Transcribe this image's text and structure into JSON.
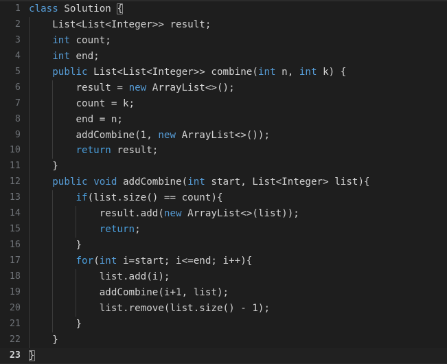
{
  "editor": {
    "name": "code-editor",
    "language": "java",
    "theme": "dark",
    "background_color": "#1e1e1e",
    "gutter_color": "#6e7277",
    "active_line_number": 23,
    "total_lines": 23,
    "colors": {
      "keyword": "#569cd6",
      "control_keyword": "#4a9edc",
      "text": "#d4d4d4",
      "active_line_bg": "#212121",
      "indent_guide": "#3b3b3b",
      "bracket_match_outline": "#8a8a8a"
    },
    "lines": [
      {
        "number": "1",
        "indent": 0,
        "tokens": [
          {
            "t": "class",
            "c": "kw"
          },
          {
            "t": " Solution ",
            "c": "plain"
          },
          {
            "t": "{",
            "c": "plain",
            "match": true
          }
        ]
      },
      {
        "number": "2",
        "indent": 1,
        "tokens": [
          {
            "t": "    List<List<Integer>> result;",
            "c": "plain"
          }
        ]
      },
      {
        "number": "3",
        "indent": 1,
        "tokens": [
          {
            "t": "    ",
            "c": "plain"
          },
          {
            "t": "int",
            "c": "kw"
          },
          {
            "t": " count;",
            "c": "plain"
          }
        ]
      },
      {
        "number": "4",
        "indent": 1,
        "tokens": [
          {
            "t": "    ",
            "c": "plain"
          },
          {
            "t": "int",
            "c": "kw"
          },
          {
            "t": " end;",
            "c": "plain"
          }
        ]
      },
      {
        "number": "5",
        "indent": 1,
        "tokens": [
          {
            "t": "    ",
            "c": "plain"
          },
          {
            "t": "public",
            "c": "kw"
          },
          {
            "t": " List<List<Integer>> combine(",
            "c": "plain"
          },
          {
            "t": "int",
            "c": "kw"
          },
          {
            "t": " n, ",
            "c": "plain"
          },
          {
            "t": "int",
            "c": "kw"
          },
          {
            "t": " k) {",
            "c": "plain"
          }
        ]
      },
      {
        "number": "6",
        "indent": 2,
        "tokens": [
          {
            "t": "        result = ",
            "c": "plain"
          },
          {
            "t": "new",
            "c": "kw"
          },
          {
            "t": " ArrayList<>();",
            "c": "plain"
          }
        ]
      },
      {
        "number": "7",
        "indent": 2,
        "tokens": [
          {
            "t": "        count = k;",
            "c": "plain"
          }
        ]
      },
      {
        "number": "8",
        "indent": 2,
        "tokens": [
          {
            "t": "        end = n;",
            "c": "plain"
          }
        ]
      },
      {
        "number": "9",
        "indent": 2,
        "tokens": [
          {
            "t": "        addCombine(",
            "c": "plain"
          },
          {
            "t": "1",
            "c": "num"
          },
          {
            "t": ", ",
            "c": "plain"
          },
          {
            "t": "new",
            "c": "kw"
          },
          {
            "t": " ArrayList<>());",
            "c": "plain"
          }
        ]
      },
      {
        "number": "10",
        "indent": 2,
        "tokens": [
          {
            "t": "        ",
            "c": "plain"
          },
          {
            "t": "return",
            "c": "ctrl"
          },
          {
            "t": " result;",
            "c": "plain"
          }
        ]
      },
      {
        "number": "11",
        "indent": 1,
        "tokens": [
          {
            "t": "    }",
            "c": "plain"
          }
        ]
      },
      {
        "number": "12",
        "indent": 1,
        "tokens": [
          {
            "t": "    ",
            "c": "plain"
          },
          {
            "t": "public",
            "c": "kw"
          },
          {
            "t": " ",
            "c": "plain"
          },
          {
            "t": "void",
            "c": "kw"
          },
          {
            "t": " addCombine(",
            "c": "plain"
          },
          {
            "t": "int",
            "c": "kw"
          },
          {
            "t": " start, List<Integer> list){",
            "c": "plain"
          }
        ]
      },
      {
        "number": "13",
        "indent": 2,
        "tokens": [
          {
            "t": "        ",
            "c": "plain"
          },
          {
            "t": "if",
            "c": "ctrl"
          },
          {
            "t": "(list.size() == count){",
            "c": "plain"
          }
        ]
      },
      {
        "number": "14",
        "indent": 3,
        "tokens": [
          {
            "t": "            result.add(",
            "c": "plain"
          },
          {
            "t": "new",
            "c": "kw"
          },
          {
            "t": " ArrayList<>(list));",
            "c": "plain"
          }
        ]
      },
      {
        "number": "15",
        "indent": 3,
        "tokens": [
          {
            "t": "            ",
            "c": "plain"
          },
          {
            "t": "return",
            "c": "ctrl"
          },
          {
            "t": ";",
            "c": "plain"
          }
        ]
      },
      {
        "number": "16",
        "indent": 2,
        "tokens": [
          {
            "t": "        }",
            "c": "plain"
          }
        ]
      },
      {
        "number": "17",
        "indent": 2,
        "tokens": [
          {
            "t": "        ",
            "c": "plain"
          },
          {
            "t": "for",
            "c": "ctrl"
          },
          {
            "t": "(",
            "c": "plain"
          },
          {
            "t": "int",
            "c": "kw"
          },
          {
            "t": " i=start; i<=end; i++){",
            "c": "plain"
          }
        ]
      },
      {
        "number": "18",
        "indent": 3,
        "tokens": [
          {
            "t": "            list.add(i);",
            "c": "plain"
          }
        ]
      },
      {
        "number": "19",
        "indent": 3,
        "tokens": [
          {
            "t": "            addCombine(i+",
            "c": "plain"
          },
          {
            "t": "1",
            "c": "num"
          },
          {
            "t": ", list);",
            "c": "plain"
          }
        ]
      },
      {
        "number": "20",
        "indent": 3,
        "tokens": [
          {
            "t": "            list.remove(list.size() - ",
            "c": "plain"
          },
          {
            "t": "1",
            "c": "num"
          },
          {
            "t": ");",
            "c": "plain"
          }
        ]
      },
      {
        "number": "21",
        "indent": 2,
        "tokens": [
          {
            "t": "        }",
            "c": "plain"
          }
        ]
      },
      {
        "number": "22",
        "indent": 1,
        "tokens": [
          {
            "t": "    }",
            "c": "plain"
          }
        ]
      },
      {
        "number": "23",
        "indent": 0,
        "active": true,
        "tokens": [
          {
            "t": "}",
            "c": "plain",
            "match": true
          }
        ]
      }
    ]
  }
}
